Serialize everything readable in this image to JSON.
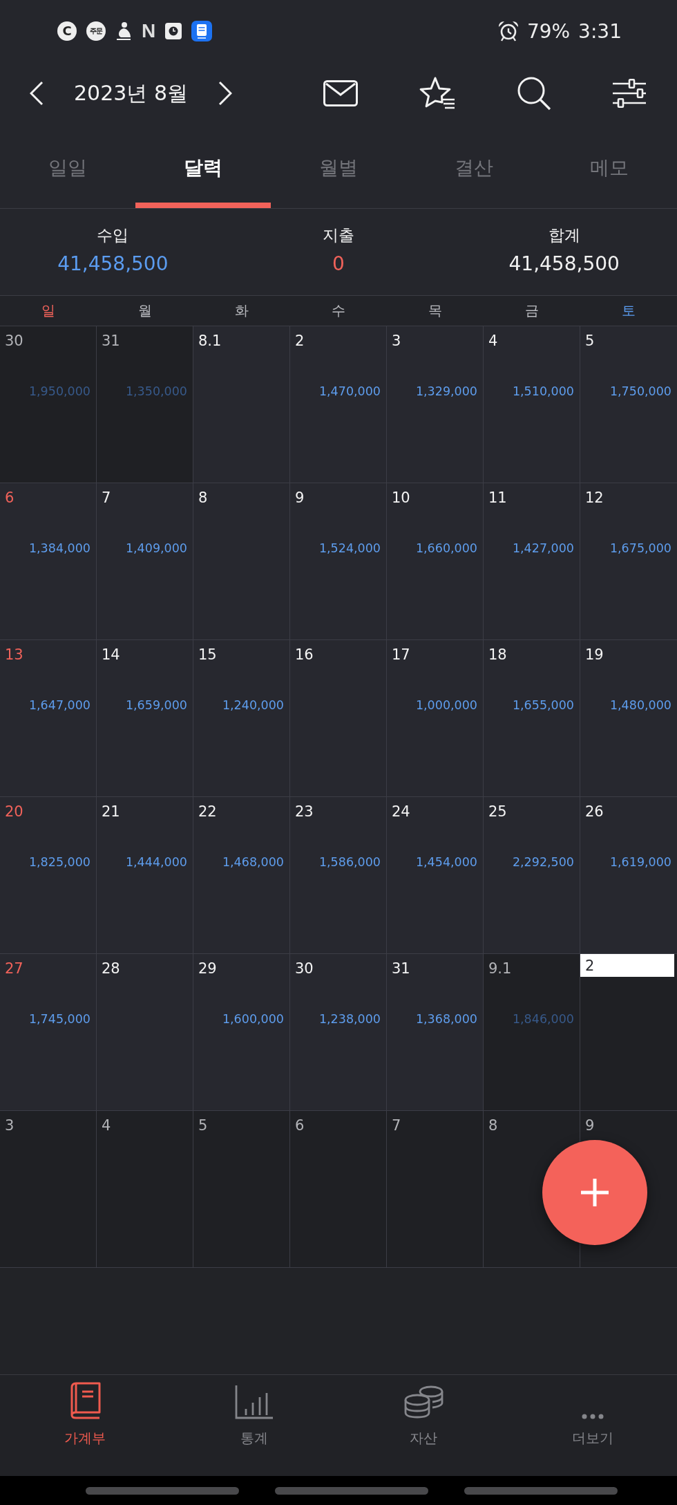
{
  "status_bar": {
    "notifications": [
      {
        "kind": "badge",
        "text": "C"
      },
      {
        "kind": "badge",
        "text": "주문"
      },
      {
        "kind": "figure"
      },
      {
        "kind": "letter",
        "text": "N"
      },
      {
        "kind": "clock"
      },
      {
        "kind": "app"
      }
    ],
    "alarm": true,
    "battery": "79%",
    "time": "3:31"
  },
  "header": {
    "title": "2023년 8월"
  },
  "tabs": [
    {
      "label": "일일",
      "selected": false
    },
    {
      "label": "달력",
      "selected": true
    },
    {
      "label": "월별",
      "selected": false
    },
    {
      "label": "결산",
      "selected": false
    },
    {
      "label": "메모",
      "selected": false
    }
  ],
  "summary": [
    {
      "kind": "income",
      "label": "수입",
      "value": "41,458,500"
    },
    {
      "kind": "expense",
      "label": "지출",
      "value": "0"
    },
    {
      "kind": "total",
      "label": "합계",
      "value": "41,458,500"
    }
  ],
  "weekdays": [
    {
      "label": "일",
      "kind": "sunday"
    },
    {
      "label": "월",
      "kind": "weekday"
    },
    {
      "label": "화",
      "kind": "weekday"
    },
    {
      "label": "수",
      "kind": "weekday"
    },
    {
      "label": "목",
      "kind": "weekday"
    },
    {
      "label": "금",
      "kind": "weekday"
    },
    {
      "label": "토",
      "kind": "saturday"
    }
  ],
  "weeks": [
    [
      {
        "date": "30",
        "in_month": false,
        "today": false,
        "amount": "1,950,000"
      },
      {
        "date": "31",
        "in_month": false,
        "today": false,
        "amount": "1,350,000"
      },
      {
        "date": "8.1",
        "in_month": true,
        "today": false
      },
      {
        "date": "2",
        "in_month": true,
        "today": false,
        "amount": "1,470,000"
      },
      {
        "date": "3",
        "in_month": true,
        "today": false,
        "amount": "1,329,000"
      },
      {
        "date": "4",
        "in_month": true,
        "today": false,
        "amount": "1,510,000"
      },
      {
        "date": "5",
        "in_month": true,
        "today": false,
        "amount": "1,750,000"
      }
    ],
    [
      {
        "date": "6",
        "in_month": true,
        "today": false,
        "amount": "1,384,000"
      },
      {
        "date": "7",
        "in_month": true,
        "today": false,
        "amount": "1,409,000"
      },
      {
        "date": "8",
        "in_month": true,
        "today": false
      },
      {
        "date": "9",
        "in_month": true,
        "today": false,
        "amount": "1,524,000"
      },
      {
        "date": "10",
        "in_month": true,
        "today": false,
        "amount": "1,660,000"
      },
      {
        "date": "11",
        "in_month": true,
        "today": false,
        "amount": "1,427,000"
      },
      {
        "date": "12",
        "in_month": true,
        "today": false,
        "amount": "1,675,000"
      }
    ],
    [
      {
        "date": "13",
        "in_month": true,
        "today": false,
        "amount": "1,647,000"
      },
      {
        "date": "14",
        "in_month": true,
        "today": false,
        "amount": "1,659,000"
      },
      {
        "date": "15",
        "in_month": true,
        "today": false,
        "amount": "1,240,000"
      },
      {
        "date": "16",
        "in_month": true,
        "today": false
      },
      {
        "date": "17",
        "in_month": true,
        "today": false,
        "amount": "1,000,000"
      },
      {
        "date": "18",
        "in_month": true,
        "today": false,
        "amount": "1,655,000"
      },
      {
        "date": "19",
        "in_month": true,
        "today": false,
        "amount": "1,480,000"
      }
    ],
    [
      {
        "date": "20",
        "in_month": true,
        "today": false,
        "amount": "1,825,000"
      },
      {
        "date": "21",
        "in_month": true,
        "today": false,
        "amount": "1,444,000"
      },
      {
        "date": "22",
        "in_month": true,
        "today": false,
        "amount": "1,468,000"
      },
      {
        "date": "23",
        "in_month": true,
        "today": false,
        "amount": "1,586,000"
      },
      {
        "date": "24",
        "in_month": true,
        "today": false,
        "amount": "1,454,000"
      },
      {
        "date": "25",
        "in_month": true,
        "today": false,
        "amount": "2,292,500"
      },
      {
        "date": "26",
        "in_month": true,
        "today": false,
        "amount": "1,619,000"
      }
    ],
    [
      {
        "date": "27",
        "in_month": true,
        "today": false,
        "amount": "1,745,000"
      },
      {
        "date": "28",
        "in_month": true,
        "today": false
      },
      {
        "date": "29",
        "in_month": true,
        "today": false,
        "amount": "1,600,000"
      },
      {
        "date": "30",
        "in_month": true,
        "today": false,
        "amount": "1,238,000"
      },
      {
        "date": "31",
        "in_month": true,
        "today": false,
        "amount": "1,368,000"
      },
      {
        "date": "9.1",
        "in_month": false,
        "today": false,
        "amount": "1,846,000"
      },
      {
        "date": "2",
        "in_month": false,
        "today": true
      }
    ],
    [
      {
        "date": "3",
        "in_month": false,
        "today": false
      },
      {
        "date": "4",
        "in_month": false,
        "today": false
      },
      {
        "date": "5",
        "in_month": false,
        "today": false
      },
      {
        "date": "6",
        "in_month": false,
        "today": false
      },
      {
        "date": "7",
        "in_month": false,
        "today": false
      },
      {
        "date": "8",
        "in_month": false,
        "today": false
      },
      {
        "date": "9",
        "in_month": false,
        "today": false
      }
    ]
  ],
  "bottom_nav": [
    {
      "kind": "book",
      "label": "가계부",
      "selected": true
    },
    {
      "kind": "chart",
      "label": "통계",
      "selected": false
    },
    {
      "kind": "coins",
      "label": "자산",
      "selected": false
    },
    {
      "kind": "more",
      "label": "더보기",
      "selected": false
    }
  ]
}
